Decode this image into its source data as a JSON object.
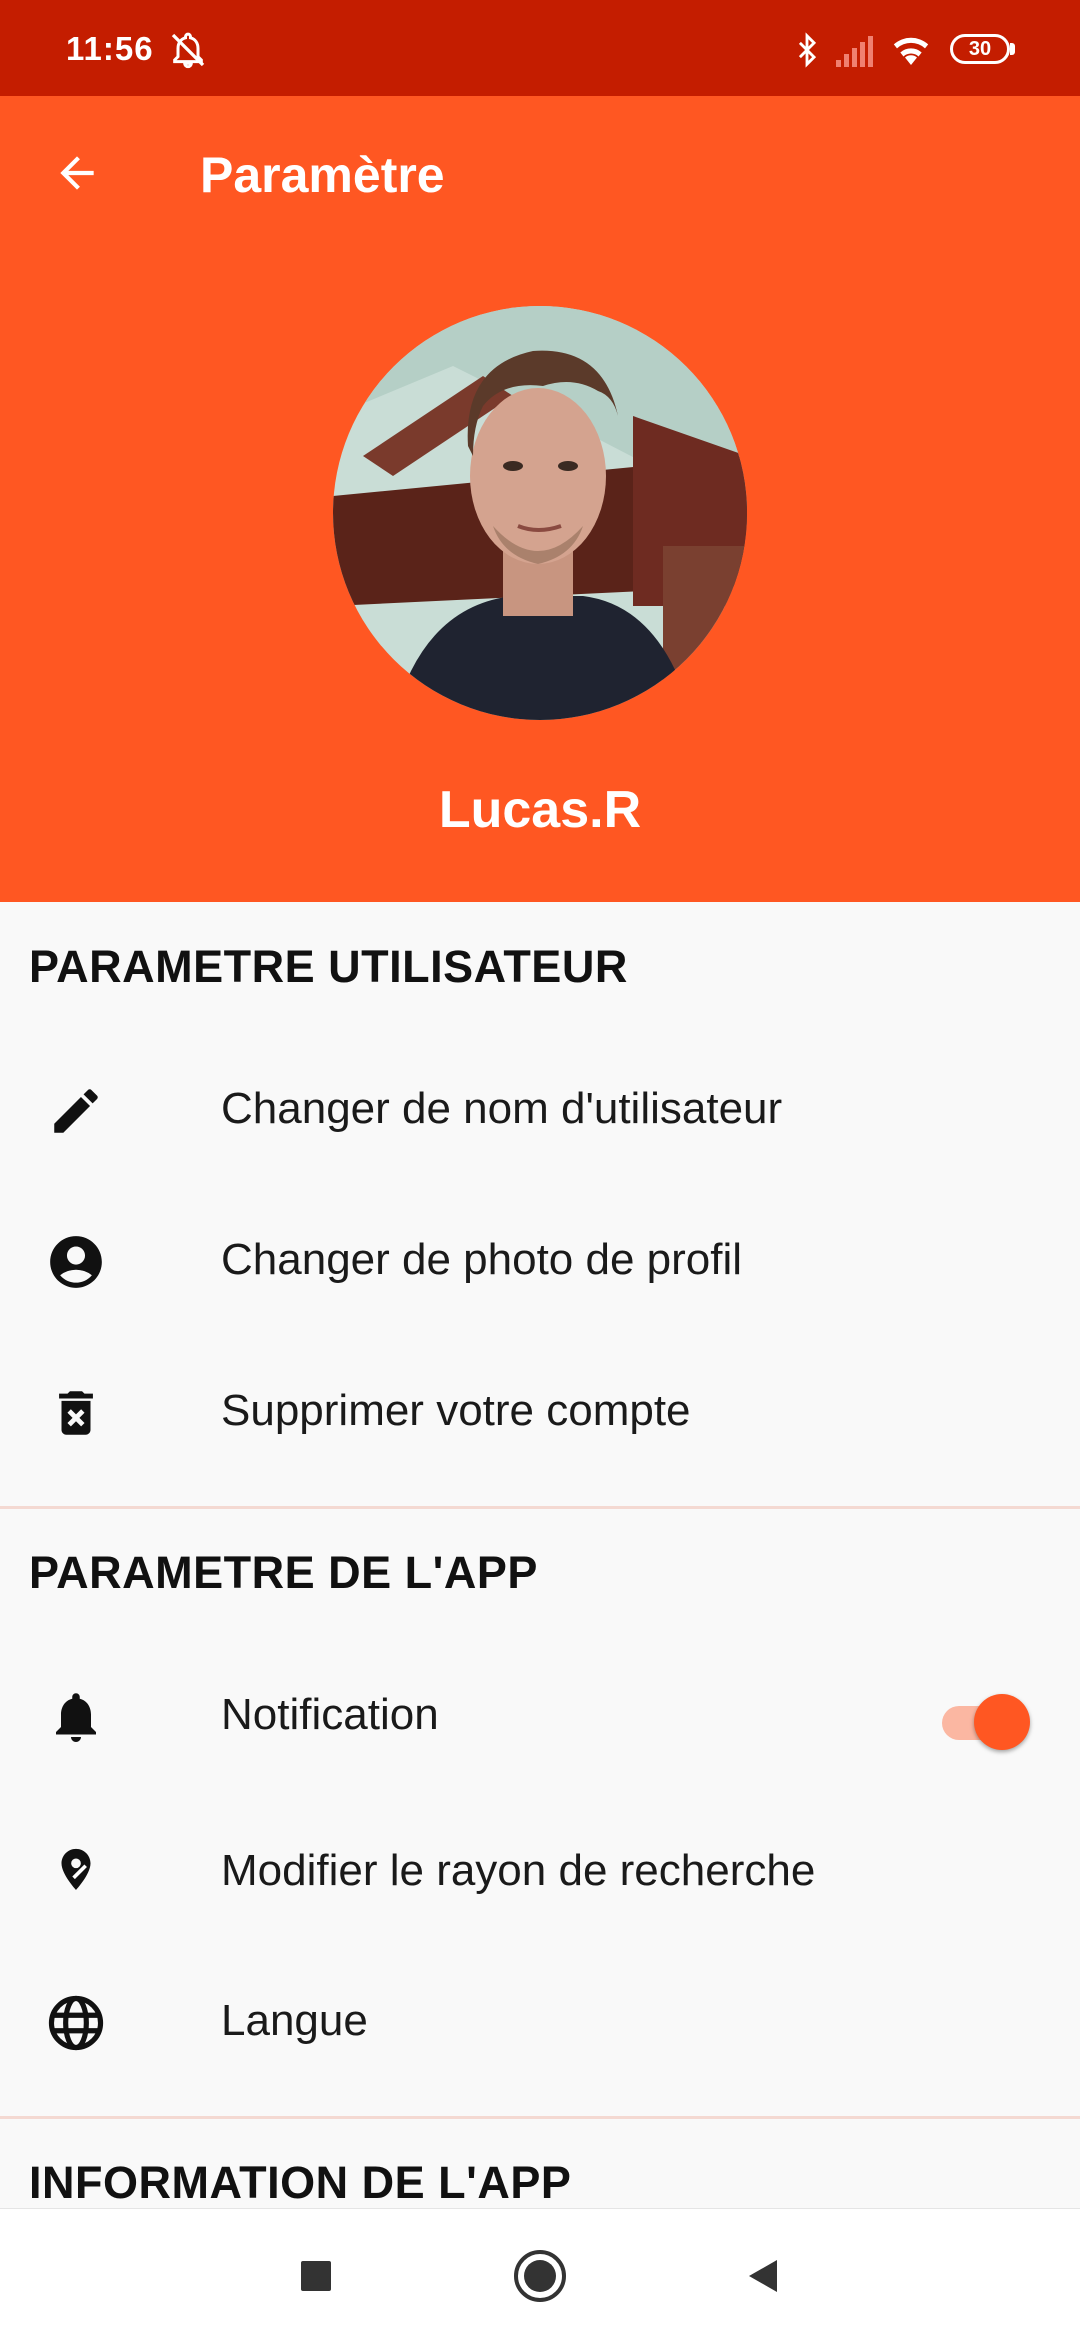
{
  "status_bar": {
    "time": "11:56",
    "battery": "30",
    "icons": [
      "mute-icon",
      "bluetooth-icon",
      "signal-icon",
      "wifi-icon",
      "battery-icon"
    ]
  },
  "header": {
    "title": "Paramètre",
    "username": "Lucas.R",
    "background_color": "#ff5722"
  },
  "sections": {
    "user": {
      "title": "PARAMETRE UTILISATEUR",
      "items": [
        {
          "label": "Changer de nom d'utilisateur",
          "icon": "pencil-icon"
        },
        {
          "label": "Changer de photo de profil",
          "icon": "account-circle-icon"
        },
        {
          "label": "Supprimer votre compte",
          "icon": "delete-forever-icon"
        }
      ]
    },
    "app": {
      "title": "PARAMETRE DE L'APP",
      "items": [
        {
          "label": "Notification",
          "icon": "bell-icon",
          "toggle_on": true
        },
        {
          "label": "Modifier le rayon de recherche",
          "icon": "location-pin-icon"
        },
        {
          "label": "Langue",
          "icon": "globe-icon"
        }
      ]
    },
    "info": {
      "title": "INFORMATION DE L'APP"
    }
  },
  "nav_bar": {
    "buttons": [
      "recents-square-icon",
      "home-circle-icon",
      "back-triangle-icon"
    ]
  }
}
